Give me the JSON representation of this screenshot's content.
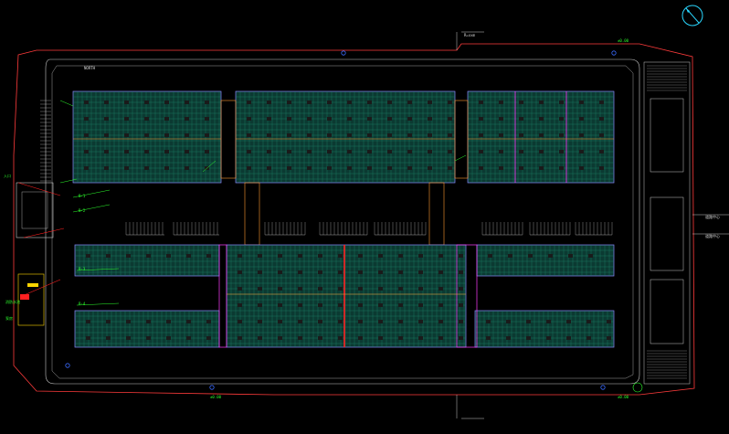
{
  "drawing": {
    "background": "#000000",
    "colors": {
      "boundary": "#ff3b3b",
      "road": "#c8c8c8",
      "wall": "#8a8aff",
      "grid": "#1f8a6a",
      "grid_fill": "#0b3a32",
      "equipment": "#1a1a1a",
      "accent_magenta": "#ff3cff",
      "accent_orange": "#ff9b2f",
      "accent_green": "#2cff2c",
      "accent_red": "#ff2020",
      "accent_blue": "#3a6bff",
      "accent_yellow": "#ffd400"
    },
    "icons": [
      "compass-icon",
      "north-arrow-icon"
    ]
  },
  "labels": {
    "top_road": "R=xxm",
    "top_gate": "±0.00",
    "bottom_gate_left": "±0.00",
    "bottom_gate_right": "±0.00",
    "right_road_a": "道路中心",
    "right_road_b": "道路中心",
    "left_entry": "入口",
    "left_legend_1": "消防水池",
    "left_legend_2": "泵房",
    "callout_1": "NORTH",
    "callout_2": "B-1",
    "callout_3": "B-2",
    "callout_4": "B-3",
    "callout_5": "B-4"
  }
}
